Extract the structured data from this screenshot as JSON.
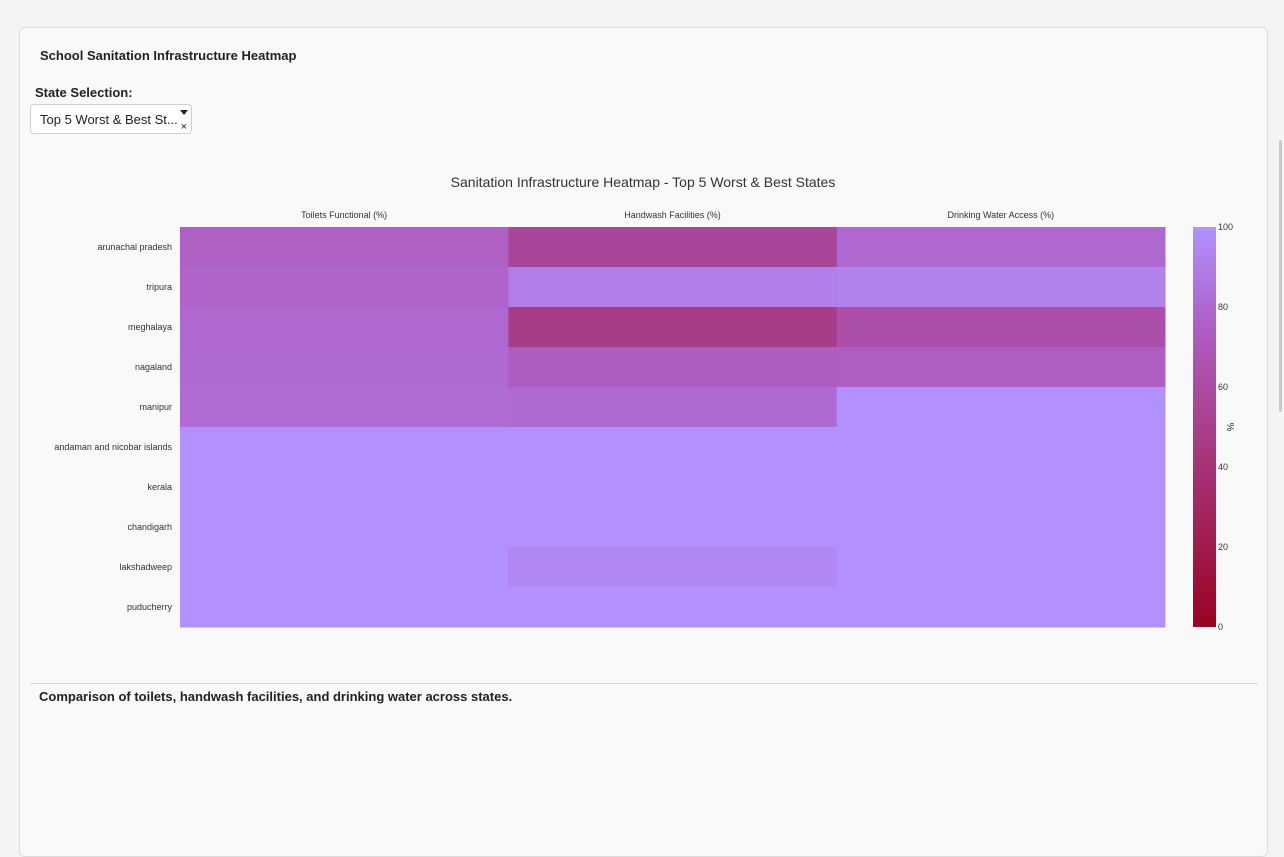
{
  "card": {
    "title": "School Sanitation Infrastructure Heatmap"
  },
  "filter": {
    "label": "State Selection:",
    "selected": "Top 5 Worst & Best St...",
    "clear_symbol": "×"
  },
  "chart_data": {
    "type": "heatmap",
    "title": "Sanitation Infrastructure Heatmap - Top 5 Worst & Best States",
    "columns": [
      "Toilets Functional (%)",
      "Handwash Facilities (%)",
      "Drinking Water Access (%)"
    ],
    "rows": [
      "arunachal pradesh",
      "tripura",
      "meghalaya",
      "nagaland",
      "manipur",
      "andaman and nicobar islands",
      "kerala",
      "chandigarh",
      "lakshadweep",
      "puducherry"
    ],
    "values": [
      [
        76,
        55,
        80
      ],
      [
        78,
        91,
        92
      ],
      [
        80,
        48,
        63
      ],
      [
        81,
        73,
        74
      ],
      [
        82,
        81,
        100
      ],
      [
        100,
        100,
        100
      ],
      [
        100,
        100,
        100
      ],
      [
        100,
        100,
        100
      ],
      [
        100,
        95,
        100
      ],
      [
        100,
        100,
        100
      ]
    ],
    "zmin": 0,
    "zmax": 100,
    "colorbar": {
      "title": "%",
      "ticks": [
        "0",
        "20",
        "40",
        "60",
        "80",
        "100"
      ],
      "color_low": "#9b0222",
      "color_mid": "#ae5ec3",
      "color_high": "#b291ff"
    }
  },
  "footer": {
    "comparison_text": "Comparison of toilets, handwash facilities, and drinking water across states."
  }
}
